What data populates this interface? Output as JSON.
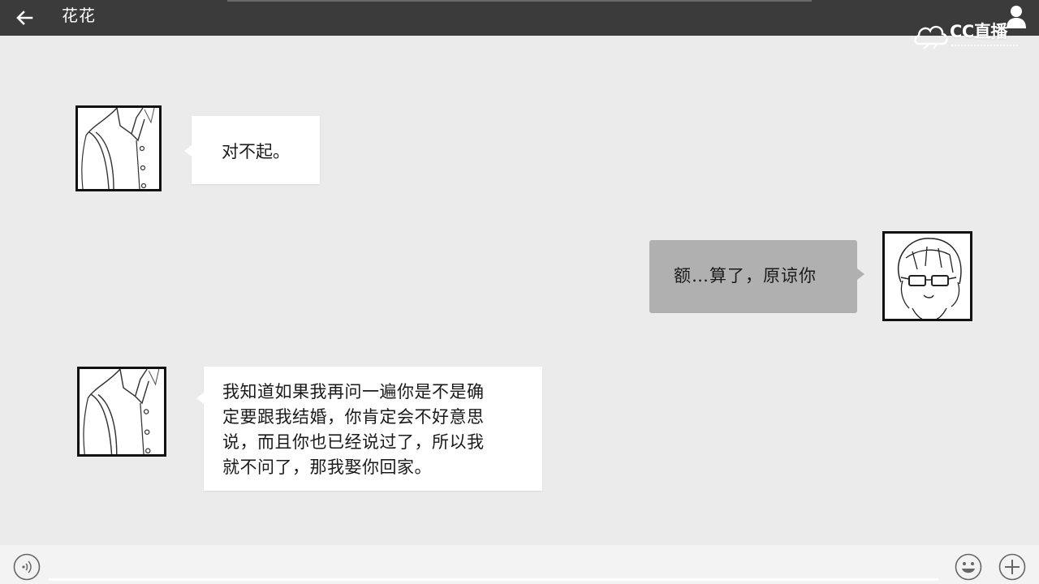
{
  "header": {
    "contact_name": "花花"
  },
  "watermark": {
    "text": "CC直播"
  },
  "messages": [
    {
      "sender": "花花",
      "side": "left",
      "avatar": "shirt-avatar",
      "text": "对不起。"
    },
    {
      "sender": "me",
      "side": "right",
      "avatar": "glasses-girl-avatar",
      "text": "额…算了，原谅你"
    },
    {
      "sender": "花花",
      "side": "left",
      "avatar": "shirt-avatar",
      "lines": [
        "我知道如果我再问一遍你是不是确",
        "定要跟我结婚，你肯定会不好意思",
        "说，而且你也已经说过了，所以我",
        "就不问了，那我娶你回家。"
      ]
    }
  ],
  "input_bar": {
    "left_icon": "voice-icon",
    "right_icons": [
      "emoji-icon",
      "plus-icon"
    ]
  },
  "colors": {
    "header_bg": "#3b3b3b",
    "chat_bg": "#ebebeb",
    "incoming_bubble": "#ffffff",
    "outgoing_bubble": "#b0b0b0",
    "input_bar_bg": "#f3f3f3"
  }
}
